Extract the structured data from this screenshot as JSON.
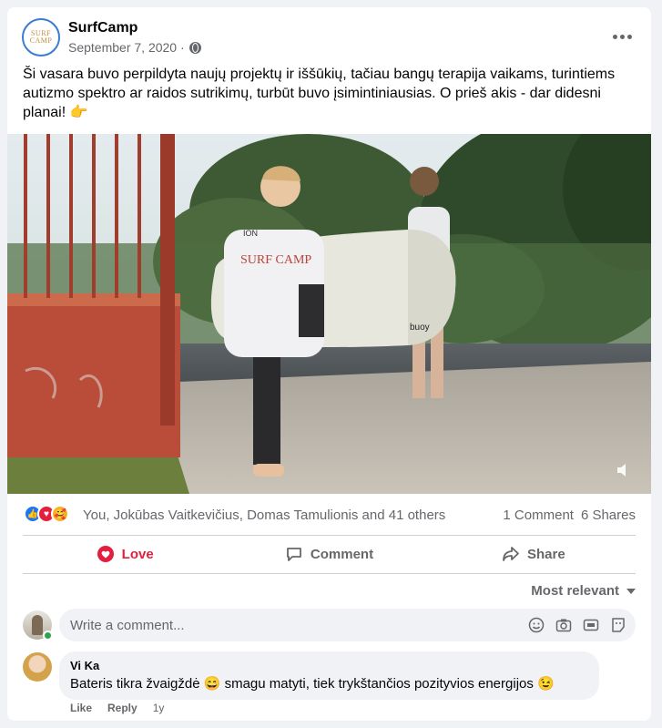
{
  "post": {
    "page_name": "SurfCamp",
    "logo_text": "SURF CAMP",
    "date": "September 7, 2020 ·",
    "text": "Ši vasara buvo perpildyta naujų projektų ir iššūkių, tačiau bangų terapija vaikams, turintiems autizmo spektro ar raidos sutrikimų, turbūt buvo įsimintiniausias. O prieš akis - dar didesni planai!",
    "text_emoji": "👉"
  },
  "media": {
    "wetsuit_text": "SURF CAMP",
    "board_text": "buoy",
    "vest_text": "ION"
  },
  "reactions": {
    "reactors": "You, Jokūbas Vaitkevičius, Domas Tamulionis and 41 others",
    "comments_count": "1 Comment",
    "shares_count": "6 Shares"
  },
  "actions": {
    "love_label": "Love",
    "comment_label": "Comment",
    "share_label": "Share"
  },
  "comments": {
    "sort_label": "Most relevant",
    "input_placeholder": "Write a comment...",
    "items": [
      {
        "author": "Vi Ka",
        "text": "Bateris tikra žvaigždė 😄 smagu matyti, tiek trykštančios pozityvios energijos 😉",
        "like_label": "Like",
        "reply_label": "Reply",
        "time": "1y"
      }
    ]
  },
  "colors": {
    "love": "#e41e3f",
    "like_blue": "#1877f2",
    "secondary_text": "#65676b",
    "online": "#31a24c"
  }
}
